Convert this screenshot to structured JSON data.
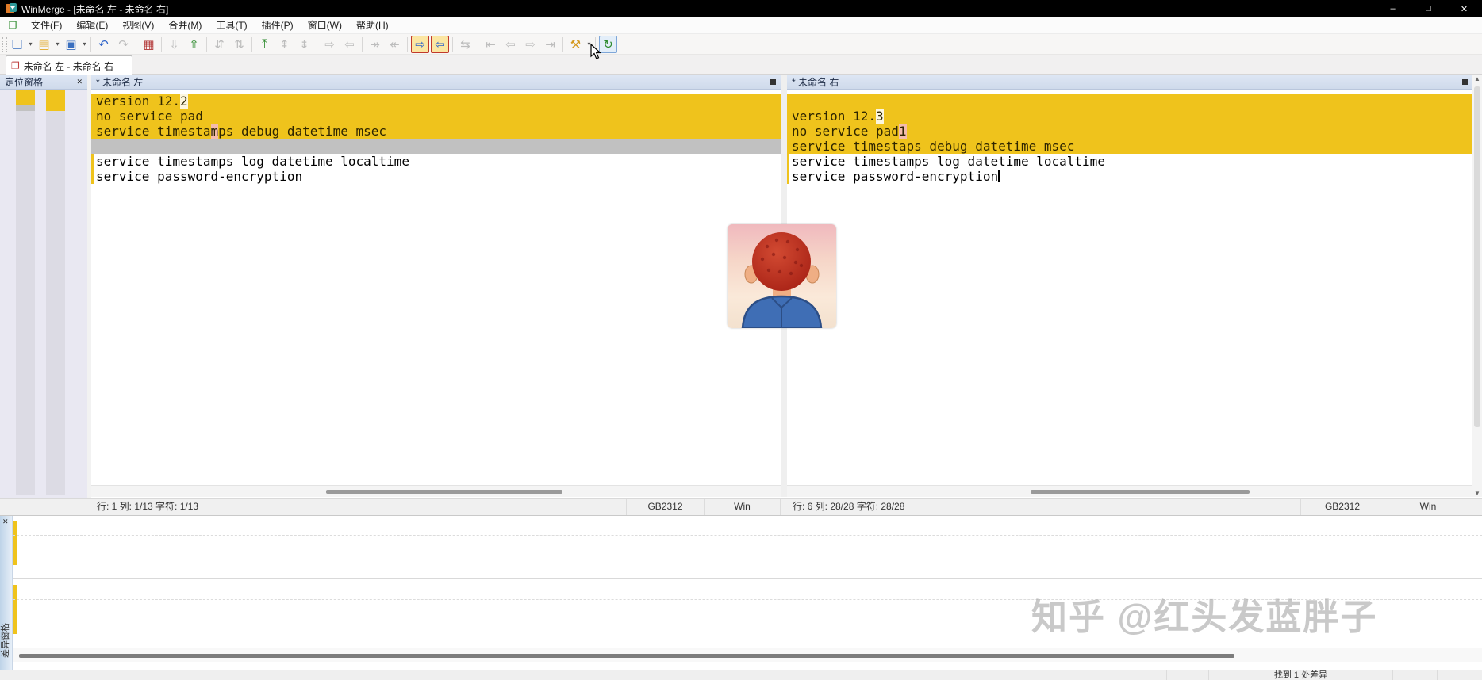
{
  "window": {
    "title": "WinMerge - [未命名 左 - 未命名 右]",
    "controls": {
      "minimize": "–",
      "maximize": "□",
      "close": "✕"
    }
  },
  "menu": {
    "items": [
      "文件(F)",
      "编辑(E)",
      "视图(V)",
      "合并(M)",
      "工具(T)",
      "插件(P)",
      "窗口(W)",
      "帮助(H)"
    ]
  },
  "toolbar": {
    "buttons": [
      {
        "name": "new-file",
        "glyph": "❏",
        "color": "#3A6FBF",
        "dd": true
      },
      {
        "name": "open-file",
        "glyph": "▤",
        "color": "#E0A826",
        "dd": true
      },
      {
        "name": "save",
        "glyph": "▣",
        "color": "#3A6FBF",
        "dd": true
      },
      {
        "sep": true
      },
      {
        "name": "undo",
        "glyph": "↶",
        "color": "#2E63C9"
      },
      {
        "name": "redo",
        "glyph": "↷",
        "state": "d"
      },
      {
        "sep": true
      },
      {
        "name": "rescan",
        "glyph": "▦",
        "color": "#B03030"
      },
      {
        "sep": true
      },
      {
        "name": "view-line-diffs",
        "glyph": "⇩",
        "state": "d"
      },
      {
        "name": "swap-panes",
        "glyph": "⇧",
        "color": "#2E8B2E"
      },
      {
        "sep": true
      },
      {
        "name": "prev-page",
        "glyph": "⇵",
        "state": "d"
      },
      {
        "name": "next-page",
        "glyph": "⇅",
        "state": "d"
      },
      {
        "sep": true
      },
      {
        "name": "first-diff",
        "glyph": "⤒",
        "color": "#2E8B2E"
      },
      {
        "name": "prev-conflict",
        "glyph": "⇞",
        "state": "d"
      },
      {
        "name": "next-conflict",
        "glyph": "⇟",
        "state": "d"
      },
      {
        "sep": true
      },
      {
        "name": "goto-right",
        "glyph": "⇨",
        "state": "d"
      },
      {
        "name": "goto-left",
        "glyph": "⇦",
        "state": "d"
      },
      {
        "sep": true
      },
      {
        "name": "copy-right-advance",
        "glyph": "↠",
        "state": "d"
      },
      {
        "name": "copy-left-advance",
        "glyph": "↞",
        "state": "d"
      },
      {
        "sep": true
      },
      {
        "name": "copy-to-right",
        "glyph": "⇨",
        "color": "#2E63C9",
        "state": "act"
      },
      {
        "name": "copy-to-left",
        "glyph": "⇦",
        "color": "#2E63C9",
        "state": "act"
      },
      {
        "sep": true
      },
      {
        "name": "auto-merge",
        "glyph": "⇆",
        "state": "d"
      },
      {
        "sep": true
      },
      {
        "name": "first-file",
        "glyph": "⇤",
        "state": "d"
      },
      {
        "name": "prev-file",
        "glyph": "⇦",
        "state": "d"
      },
      {
        "name": "next-file",
        "glyph": "⇨",
        "state": "d"
      },
      {
        "name": "last-file",
        "glyph": "⇥",
        "state": "d"
      },
      {
        "sep": true
      },
      {
        "name": "plugins",
        "glyph": "⚒",
        "color": "#D59A20",
        "dd": true
      },
      {
        "sep": true
      },
      {
        "name": "refresh",
        "glyph": "↻",
        "color": "#2E8B2E",
        "state": "hov"
      }
    ]
  },
  "tabs": {
    "active_label": "未命名 左 - 未命名 右"
  },
  "location_pane": {
    "title": "定位窗格",
    "close": "✕"
  },
  "panes": {
    "left": {
      "header": "* 未命名 左",
      "lines": [
        {
          "type": "diff",
          "segs": [
            {
              "t": "version 12."
            },
            {
              "t": "2",
              "hl": "cream"
            }
          ]
        },
        {
          "type": "diff",
          "segs": [
            {
              "t": "no service pad"
            }
          ]
        },
        {
          "type": "diff",
          "segs": [
            {
              "t": "service timesta"
            },
            {
              "t": "m",
              "hl": "pink"
            },
            {
              "t": "ps debug datetime msec"
            }
          ]
        },
        {
          "type": "ghost",
          "segs": []
        },
        {
          "type": "plain",
          "segs": [
            {
              "t": "service timestamps log datetime localtime"
            }
          ]
        },
        {
          "type": "plain",
          "segs": [
            {
              "t": "service password-encryption"
            }
          ]
        }
      ],
      "status": {
        "position": "行: 1  列: 1/13  字符: 1/13",
        "encoding": "GB2312",
        "eol": "Win"
      }
    },
    "right": {
      "header": "* 未命名 右",
      "lines": [
        {
          "type": "diff",
          "segs": []
        },
        {
          "type": "diff",
          "segs": [
            {
              "t": "version 12."
            },
            {
              "t": "3",
              "hl": "cream"
            }
          ]
        },
        {
          "type": "diff",
          "segs": [
            {
              "t": "no service pad"
            },
            {
              "t": "1",
              "hl": "pink"
            }
          ]
        },
        {
          "type": "diff",
          "segs": [
            {
              "t": "service timestaps debug datetime msec"
            }
          ]
        },
        {
          "type": "plain",
          "segs": [
            {
              "t": "service timestamps log datetime localtime"
            }
          ]
        },
        {
          "type": "plain",
          "segs": [
            {
              "t": "service password-encryption"
            }
          ],
          "caret": true
        }
      ],
      "status": {
        "position": "行: 6  列: 28/28  字符: 28/28",
        "encoding": "GB2312",
        "eol": "Win"
      }
    }
  },
  "diff_pane": {
    "title": "差异窗格",
    "close": "✕"
  },
  "statusbar": {
    "message": "找到 1 处差异"
  },
  "watermark": "知乎 @红头发蓝胖子",
  "colors": {
    "diff_background": "#EFC31C",
    "ghost_line": "#C1C1C1",
    "inline_diff_cream": "#FCF6DE",
    "inline_diff_pink": "#F4BBAC",
    "pane_header": "#CFDAEB",
    "titlebar": "#000000"
  }
}
